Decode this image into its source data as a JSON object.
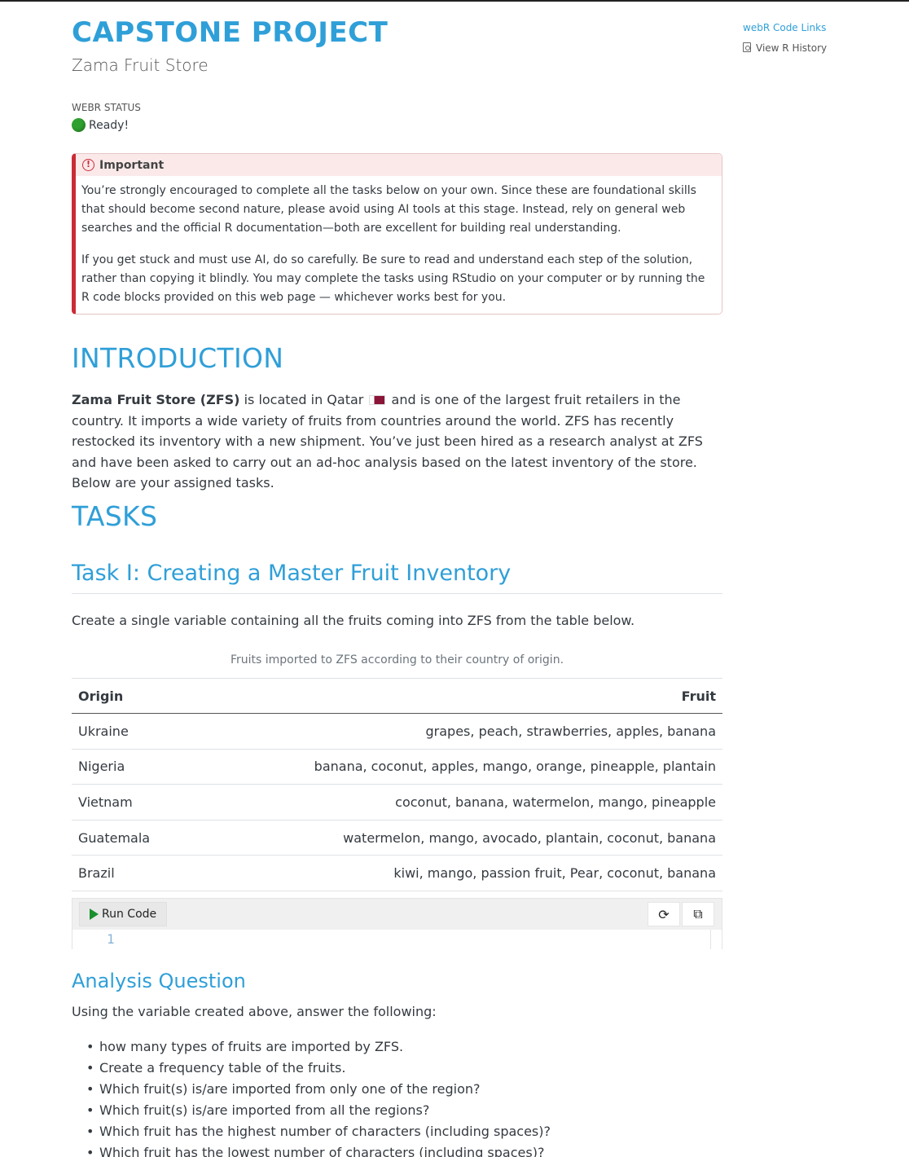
{
  "header": {
    "title": "CAPSTONE PROJECT",
    "subtitle": "Zama Fruit Store"
  },
  "webr_status": {
    "label": "WEBR STATUS",
    "value": "Ready!",
    "indicator_color": "#2ea02e"
  },
  "callout": {
    "title": "Important",
    "accent_color": "#cb2b37",
    "paragraphs": [
      "You’re strongly encouraged to complete all the tasks below on your own. Since these are foundational skills that should become second nature, please avoid using AI tools at this stage. Instead, rely on general web searches and the official R documentation—both are excellent for building real understanding.",
      "If you get stuck and must use AI, do so carefully. Be sure to read and understand each step of the solution, rather than copying it blindly. You may complete the tasks using RStudio on your computer or by running the R code blocks provided on this web page — whichever works best for you."
    ]
  },
  "introduction": {
    "heading": "INTRODUCTION",
    "bold_lead": "Zama Fruit Store (ZFS)",
    "text_before_flag": " is located in Qatar ",
    "text_after_flag": " and is one of the largest fruit retailers in the country. It imports a wide variety of fruits from countries around the world. ZFS has recently restocked its inventory with a new shipment. You’ve just been hired as a research analyst at ZFS and have been asked to carry out an ad-hoc analysis based on the latest inventory of the store. Below are your assigned tasks."
  },
  "tasks": {
    "heading": "TASKS",
    "task1": {
      "title": "Task I: Creating a Master Fruit Inventory",
      "description": "Create a single variable containing all the fruits coming into ZFS from the table below.",
      "table_caption": "Fruits imported to ZFS according to their country of origin.",
      "columns": [
        "Origin",
        "Fruit"
      ],
      "rows": [
        [
          "Ukraine",
          "grapes, peach, strawberries, apples, banana"
        ],
        [
          "Nigeria",
          "banana, coconut, apples, mango, orange, pineapple, plantain"
        ],
        [
          "Vietnam",
          "coconut, banana, watermelon, mango, pineapple"
        ],
        [
          "Guatemala",
          "watermelon, mango, avocado, plantain, coconut, banana"
        ],
        [
          "Brazil",
          "kiwi, mango, passion fruit, Pear, coconut, banana"
        ]
      ]
    }
  },
  "code_cell": {
    "run_label": "Run Code",
    "reset_icon": "refresh-icon",
    "copy_icon": "copy-icon",
    "line_number": "1"
  },
  "analysis": {
    "heading": "Analysis Question",
    "intro": "Using the variable created above, answer the following:",
    "questions": [
      "how many types of fruits are imported by ZFS.",
      "Create a frequency table of the fruits.",
      "Which fruit(s) is/are imported from only one of the region?",
      "Which fruit(s) is/are imported from all the regions?",
      "Which fruit has the highest number of characters (including spaces)?",
      "Which fruit has the lowest number of characters (including spaces)?"
    ]
  },
  "sidebar": {
    "title": "webR Code Links",
    "link": "View R History"
  }
}
